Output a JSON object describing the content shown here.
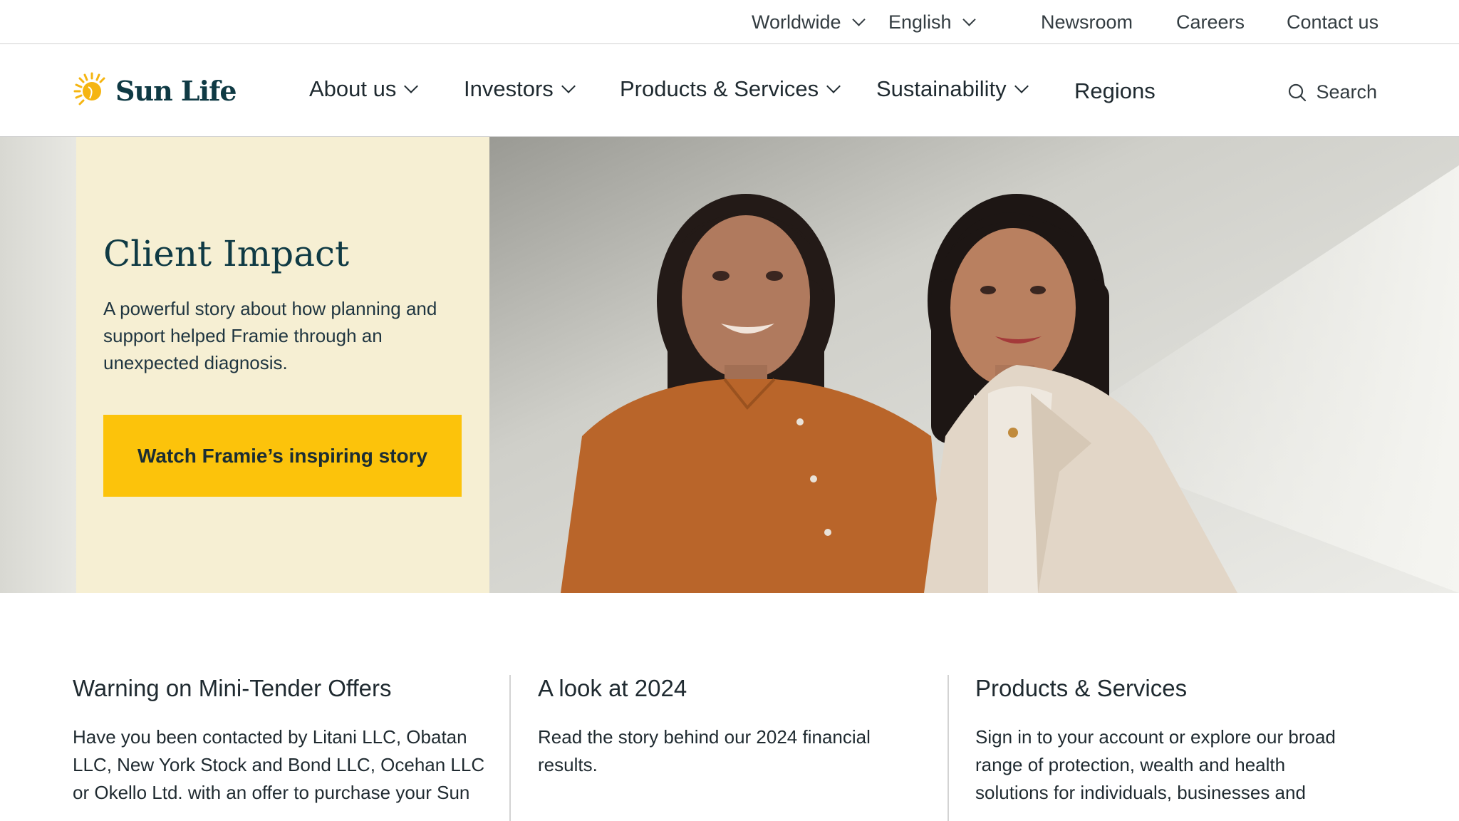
{
  "utility_nav": {
    "worldwide": "Worldwide",
    "language": "English",
    "newsroom": "Newsroom",
    "careers": "Careers",
    "contact": "Contact us"
  },
  "brand": {
    "name": "Sun Life",
    "logo_color": "#f5b511",
    "text_color": "#0f3a44"
  },
  "main_nav": {
    "items": [
      {
        "label": "About us",
        "dropdown": true
      },
      {
        "label": "Investors",
        "dropdown": true
      },
      {
        "label": "Products & Services",
        "dropdown": true
      },
      {
        "label": "Sustainability",
        "dropdown": true
      },
      {
        "label": "Regions",
        "dropdown": false
      }
    ],
    "search_label": "Search"
  },
  "hero": {
    "title": "Client Impact",
    "description": "A powerful story about how planning and support helped Framie through an unexpected diagnosis.",
    "cta_label": "Watch Framie’s inspiring story",
    "cta_color": "#fcc30b",
    "panel_color": "#f6efd3"
  },
  "cards": [
    {
      "title": "Warning on Mini-Tender Offers",
      "text": "Have you been contacted by Litani LLC, Obatan LLC, New York Stock and Bond LLC, Ocehan LLC or Okello Ltd. with an offer to purchase your Sun"
    },
    {
      "title": "A look at 2024",
      "text": "Read the story behind our 2024 financial results."
    },
    {
      "title": "Products & Services",
      "text": "Sign in to your account or explore our broad range of protection, wealth and health solutions for individuals, businesses and"
    }
  ]
}
